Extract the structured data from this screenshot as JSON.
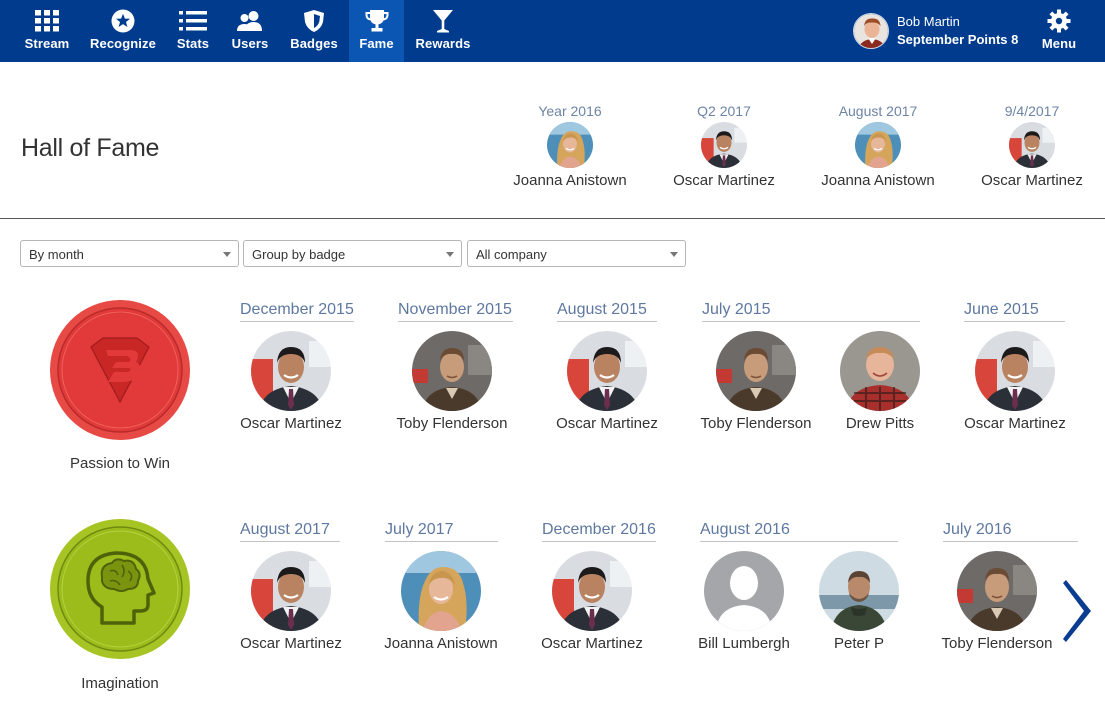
{
  "nav": {
    "items": [
      {
        "label": "Stream",
        "icon": "grid-icon"
      },
      {
        "label": "Recognize",
        "icon": "star-circle-icon"
      },
      {
        "label": "Stats",
        "icon": "list-icon"
      },
      {
        "label": "Users",
        "icon": "users-icon"
      },
      {
        "label": "Badges",
        "icon": "shield-icon"
      },
      {
        "label": "Fame",
        "icon": "trophy-icon",
        "active": true
      },
      {
        "label": "Rewards",
        "icon": "cocktail-icon"
      }
    ],
    "user": {
      "name": "Bob Martin",
      "points": "September Points 8"
    },
    "menu_label": "Menu"
  },
  "hall_of_fame": {
    "title": "Hall of Fame",
    "highlights": [
      {
        "period": "Year 2016",
        "name": "Joanna Anistown"
      },
      {
        "period": "Q2 2017",
        "name": "Oscar Martinez"
      },
      {
        "period": "August 2017",
        "name": "Joanna Anistown"
      },
      {
        "period": "9/4/2017",
        "name": "Oscar Martinez"
      }
    ]
  },
  "filters": {
    "period": "By month",
    "grouping": "Group by badge",
    "scope": "All company"
  },
  "badges": [
    {
      "name": "Passion to Win",
      "color": "#e23a3a",
      "icon": "superman-shield-icon",
      "periods": [
        {
          "label": "December 2015",
          "winners": [
            "Oscar Martinez"
          ]
        },
        {
          "label": "November 2015",
          "winners": [
            "Toby Flenderson"
          ]
        },
        {
          "label": "August 2015",
          "winners": [
            "Oscar Martinez"
          ]
        },
        {
          "label": "July 2015",
          "winners": [
            "Toby Flenderson",
            "Drew Pitts"
          ]
        },
        {
          "label": "June 2015",
          "winners": [
            "Oscar Martinez"
          ]
        }
      ]
    },
    {
      "name": "Imagination",
      "color": "#9cbc1c",
      "icon": "brain-head-icon",
      "periods": [
        {
          "label": "August 2017",
          "winners": [
            "Oscar Martinez"
          ]
        },
        {
          "label": "July 2017",
          "winners": [
            "Joanna Anistown"
          ]
        },
        {
          "label": "December 2016",
          "winners": [
            "Oscar Martinez"
          ]
        },
        {
          "label": "August 2016",
          "winners": [
            "Bill Lumbergh",
            "Peter P"
          ]
        },
        {
          "label": "July 2016",
          "winners": [
            "Toby Flenderson"
          ]
        }
      ]
    }
  ],
  "colors": {
    "nav_bg": "#003b8e",
    "nav_active": "#0c56b3",
    "period_link": "#5e78a0",
    "arrow": "#0a3d8f"
  }
}
